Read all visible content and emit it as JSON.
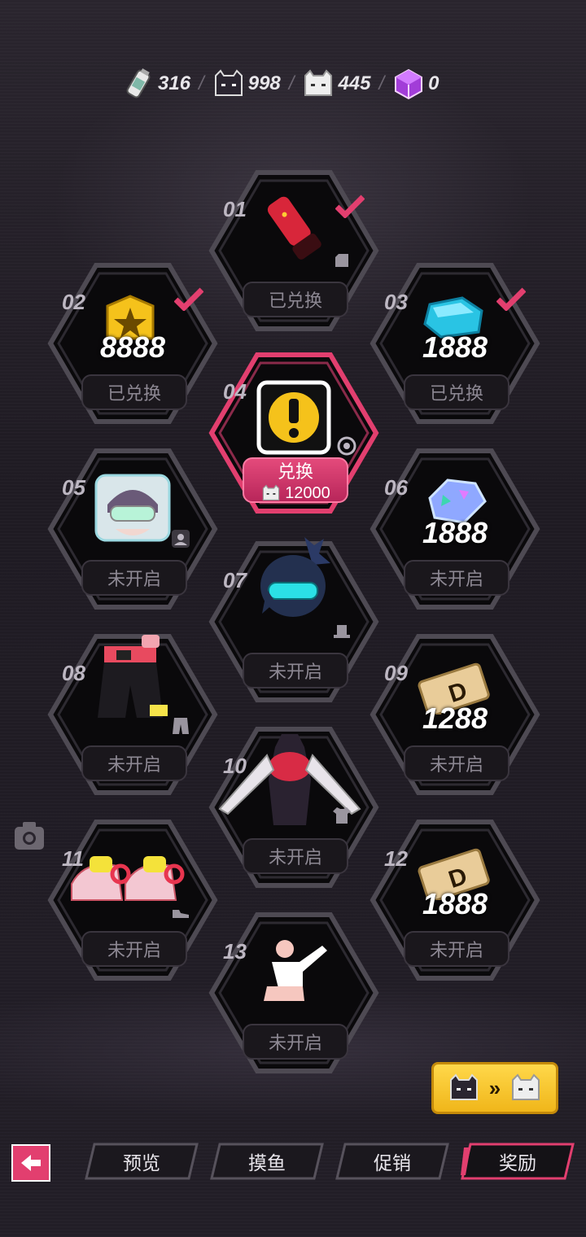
{
  "currencies": [
    {
      "name": "bottle-ticket",
      "value": "316"
    },
    {
      "name": "dark-cat-token",
      "value": "998"
    },
    {
      "name": "white-cat-token",
      "value": "445"
    },
    {
      "name": "purple-cube",
      "value": "0"
    }
  ],
  "separator": "/",
  "rewards": [
    {
      "index": "01",
      "status": "已兑换",
      "claimed": true,
      "item": "red-gauntlet-icon"
    },
    {
      "index": "02",
      "amount": "8888",
      "status": "已兑换",
      "claimed": true,
      "item": "gold-star-badge-icon"
    },
    {
      "index": "03",
      "amount": "1888",
      "status": "已兑换",
      "claimed": true,
      "item": "blue-crystal-icon"
    },
    {
      "index": "04",
      "status": "兑换",
      "cost": "12000",
      "claimed": false,
      "item": "exclamation-mark-icon"
    },
    {
      "index": "05",
      "status": "未开启",
      "claimed": false,
      "item": "avatar-portrait-icon"
    },
    {
      "index": "06",
      "amount": "1888",
      "status": "未开启",
      "claimed": false,
      "item": "holo-gem-icon"
    },
    {
      "index": "07",
      "status": "未开启",
      "claimed": false,
      "item": "hair-visor-icon"
    },
    {
      "index": "08",
      "status": "未开启",
      "claimed": false,
      "item": "shorts-outfit-icon"
    },
    {
      "index": "09",
      "amount": "1288",
      "status": "未开启",
      "claimed": false,
      "item": "d-ticket-icon"
    },
    {
      "index": "10",
      "status": "未开启",
      "claimed": false,
      "item": "top-outfit-icon"
    },
    {
      "index": "11",
      "status": "未开启",
      "claimed": false,
      "item": "sneakers-icon"
    },
    {
      "index": "12",
      "amount": "1888",
      "status": "未开启",
      "claimed": false,
      "item": "d-ticket-icon"
    },
    {
      "index": "13",
      "status": "未开启",
      "claimed": false,
      "item": "pose-emote-icon"
    }
  ],
  "tabs": [
    {
      "label": "预览",
      "active": false
    },
    {
      "label": "摸鱼",
      "active": false
    },
    {
      "label": "促销",
      "active": false
    },
    {
      "label": "奖励",
      "active": true
    }
  ],
  "colors": {
    "accent": "#e23f6f",
    "gold": "#f5c21b",
    "frame": "#5a5560"
  }
}
